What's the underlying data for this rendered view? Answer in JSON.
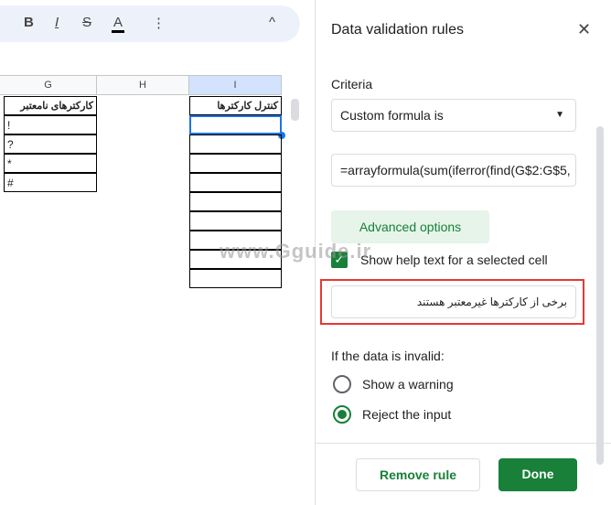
{
  "toolbar": {
    "bold": "B",
    "italic": "I",
    "strike": "S",
    "textcolor": "A",
    "more": "⋮",
    "collapse": "^"
  },
  "columns": [
    "G",
    "H",
    "I"
  ],
  "cells": {
    "g1": "کارکترهای نامعتبر",
    "i1": "کنترل کارکترها",
    "g2": "!",
    "g3": "?",
    "g4": "*",
    "g5": "#"
  },
  "panel": {
    "title": "Data validation rules",
    "criteria_label": "Criteria",
    "criteria_value": "Custom formula is",
    "formula": "=arrayformula(sum(iferror(find(G$2:G$5,",
    "advanced": "Advanced options",
    "help_check": "Show help text for a selected cell",
    "help_text": "برخی از کارکترها غیرمعتبر هستند",
    "invalid_label": "If the data is invalid:",
    "opt_warning": "Show a warning",
    "opt_reject": "Reject the input",
    "remove": "Remove rule",
    "done": "Done"
  },
  "watermark": "www.Gguide.ir",
  "colors": {
    "accent": "#188038",
    "highlight": "#e53935",
    "selection": "#1a73e8"
  }
}
